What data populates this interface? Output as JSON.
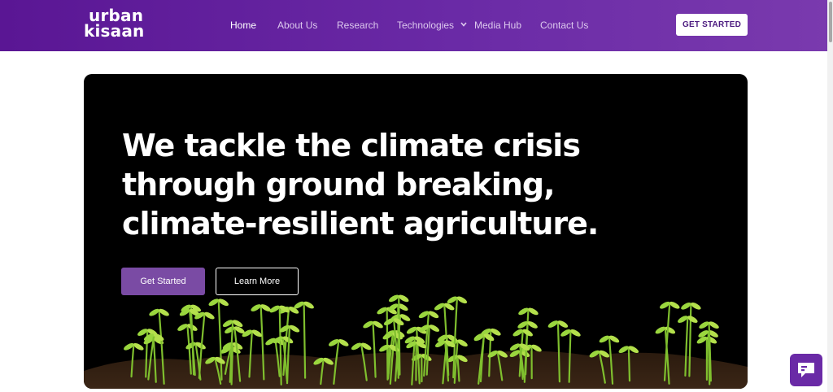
{
  "brand": {
    "line1": "urban",
    "line2": "kisaan"
  },
  "nav": {
    "items": [
      {
        "label": "Home"
      },
      {
        "label": "About Us"
      },
      {
        "label": "Research"
      },
      {
        "label": "Technologies"
      },
      {
        "label": "Media Hub"
      },
      {
        "label": "Contact Us"
      }
    ],
    "active": "Home",
    "dropdown_icon": "chevron-down-icon"
  },
  "header": {
    "cta_label": "GET STARTED"
  },
  "hero": {
    "title": "We tackle the climate crisis through ground breaking, climate-resilient agriculture.",
    "primary_label": "Get Started",
    "secondary_label": "Learn More",
    "image": "seedlings-in-soil"
  },
  "chat": {
    "icon": "chat-icon"
  },
  "colors": {
    "header_gradient_start": "#5a1694",
    "header_gradient_end": "#7a3aae",
    "primary_button": "#7a4ba4",
    "hero_background": "#000000"
  }
}
